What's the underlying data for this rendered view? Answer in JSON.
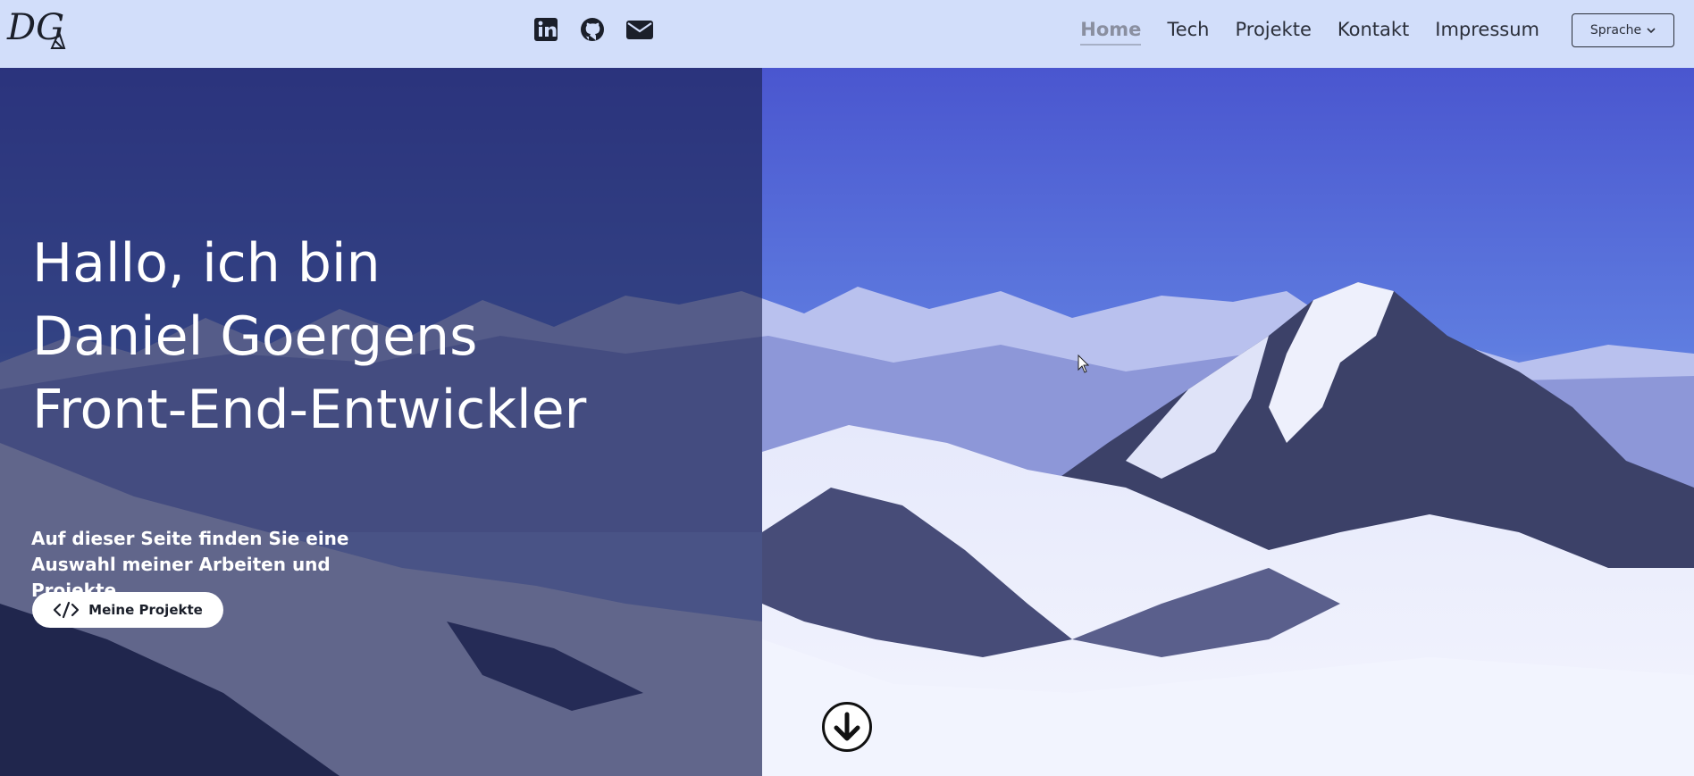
{
  "header": {
    "logo_text": "DG",
    "social_icons": [
      "linkedin-icon",
      "github-icon",
      "envelope-icon"
    ],
    "nav": [
      {
        "label": "Home",
        "active": true
      },
      {
        "label": "Tech",
        "active": false
      },
      {
        "label": "Projekte",
        "active": false
      },
      {
        "label": "Kontakt",
        "active": false
      },
      {
        "label": "Impressum",
        "active": false
      }
    ],
    "language_button": "Sprache"
  },
  "hero": {
    "title_lines": [
      "Hallo, ich bin",
      "Daniel Goergens",
      "Front-End-Entwickler"
    ],
    "description": "Auf dieser Seite finden Sie eine Auswahl meiner Arbeiten und Projekte.",
    "cta_label": "Meine Projekte",
    "cta_icon": "code-icon",
    "scroll_icon": "arrow-down-icon"
  },
  "colors": {
    "navbar_bg": "#d2defa",
    "overlay": "#181e4b",
    "sky_top": "#4a56cf",
    "text_dark": "#2b2f3a"
  }
}
